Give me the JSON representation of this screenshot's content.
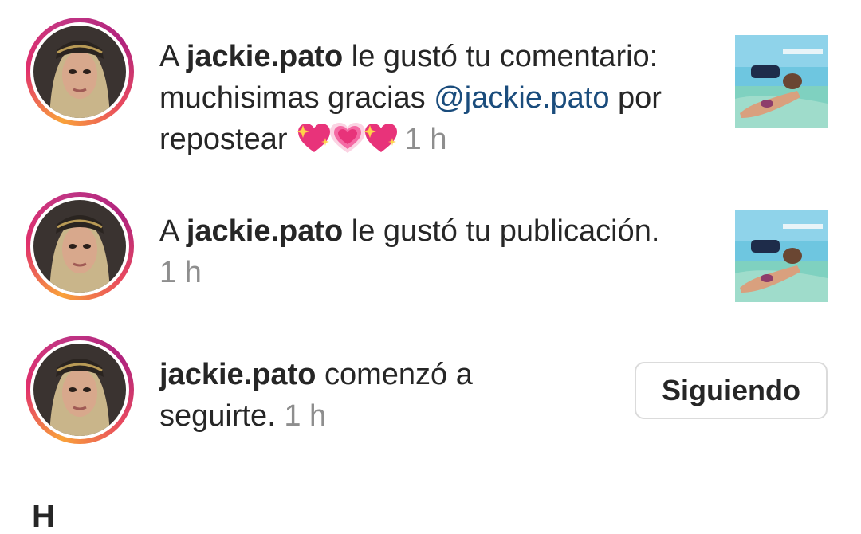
{
  "notifications": [
    {
      "prefix": "A ",
      "username": "jackie.pato",
      "action": " le gustó tu comentario:",
      "comment_before": "muchisimas gracias ",
      "mention": "@jackie.pato",
      "comment_after": " por",
      "comment_line3": "repostear ",
      "time": "1 h",
      "emoji_icons": [
        "sparkling-heart-icon",
        "growing-heart-icon",
        "sparkling-heart-icon"
      ]
    },
    {
      "prefix": "A ",
      "username": "jackie.pato",
      "action": " le gustó tu publicación.",
      "time": "1 h"
    },
    {
      "username": "jackie.pato",
      "action": " comenzó a",
      "action_line2": "seguirte.",
      "time": "1 h",
      "button_label": "Siguiendo"
    }
  ],
  "section_header_partial": "H",
  "colors": {
    "ring_gradient": [
      "#f9a23a",
      "#e1306c",
      "#c13584"
    ],
    "mention": "#1a4c7c",
    "timestamp": "#8e8e8e"
  }
}
